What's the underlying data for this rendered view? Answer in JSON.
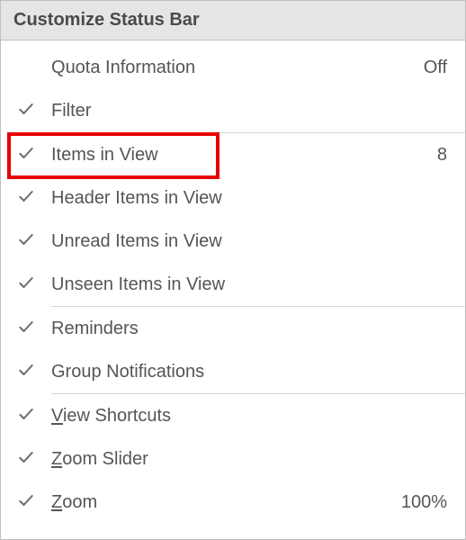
{
  "header": {
    "title": "Customize Status Bar"
  },
  "items": [
    {
      "id": "quota-information",
      "label_pre": "Q",
      "label_u": "",
      "label_post": "uota Information",
      "checked": false,
      "value": "Off",
      "sep_after": false
    },
    {
      "id": "filter",
      "label_pre": "",
      "label_u": "",
      "label_post": "Filter",
      "checked": true,
      "value": "",
      "sep_after": true
    },
    {
      "id": "items-in-view",
      "label_pre": "",
      "label_u": "",
      "label_post": "Items in View",
      "checked": true,
      "value": "8",
      "sep_after": false
    },
    {
      "id": "header-items",
      "label_pre": "",
      "label_u": "",
      "label_post": "Header Items in View",
      "checked": true,
      "value": "",
      "sep_after": false
    },
    {
      "id": "unread-items",
      "label_pre": "",
      "label_u": "",
      "label_post": "Unread Items in View",
      "checked": true,
      "value": "",
      "sep_after": false
    },
    {
      "id": "unseen-items",
      "label_pre": "",
      "label_u": "",
      "label_post": "Unseen Items in View",
      "checked": true,
      "value": "",
      "sep_after": true
    },
    {
      "id": "reminders",
      "label_pre": "",
      "label_u": "",
      "label_post": "Reminders",
      "checked": true,
      "value": "",
      "sep_after": false
    },
    {
      "id": "group-notifications",
      "label_pre": "",
      "label_u": "",
      "label_post": "Group Notifications",
      "checked": true,
      "value": "",
      "sep_after": true
    },
    {
      "id": "view-shortcuts",
      "label_pre": "",
      "label_u": "V",
      "label_post": "iew Shortcuts",
      "checked": true,
      "value": "",
      "sep_after": false
    },
    {
      "id": "zoom-slider",
      "label_pre": "",
      "label_u": "Z",
      "label_post": "oom Slider",
      "checked": true,
      "value": "",
      "sep_after": false
    },
    {
      "id": "zoom",
      "label_pre": "",
      "label_u": "Z",
      "label_post": "oom",
      "checked": true,
      "value": "100%",
      "sep_after": false
    }
  ],
  "highlight": {
    "target_id": "items-in-view"
  }
}
